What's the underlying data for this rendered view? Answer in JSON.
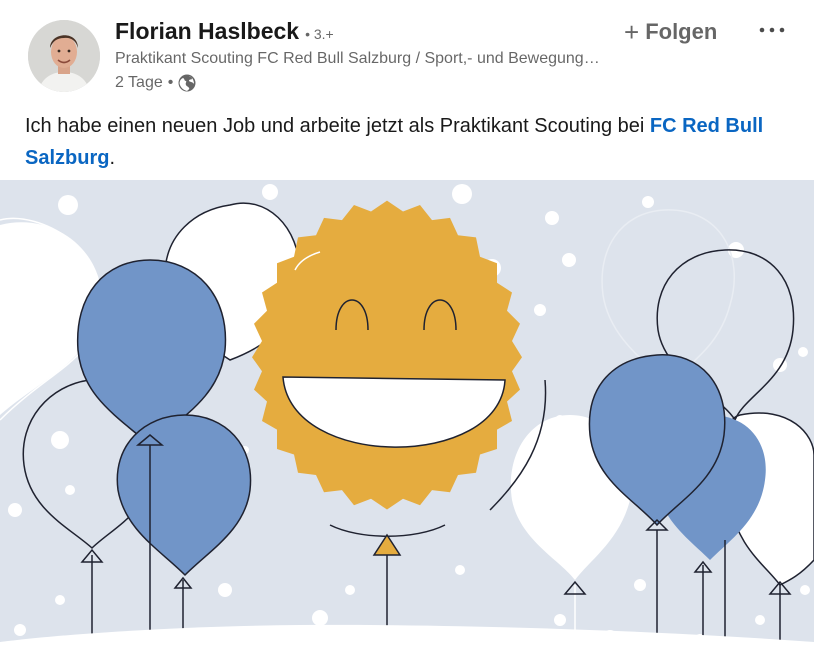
{
  "author": {
    "name": "Florian Haslbeck",
    "degree": "• 3.+",
    "headline": "Praktikant Scouting FC Red Bull Salzburg / Sport,- und Bewegungsmanagement",
    "time": "2 Tage",
    "time_separator": "•",
    "visibility_icon": "globe-icon"
  },
  "actions": {
    "follow_label": "Folgen",
    "follow_icon": "plus-icon",
    "more_icon": "ellipsis-icon"
  },
  "post": {
    "text_before": "Ich habe einen neuen Job und arbeite jetzt als Praktikant Scouting bei ",
    "mention": "FC Red Bull Salzburg",
    "text_after": "."
  },
  "image": {
    "subject": "celebration-illustration",
    "colors": {
      "background": "#dde3ec",
      "balloon_blue": "#7195c8",
      "balloon_white": "#ffffff",
      "smiley": "#e5ac3f",
      "link": "#0a66c2"
    }
  }
}
